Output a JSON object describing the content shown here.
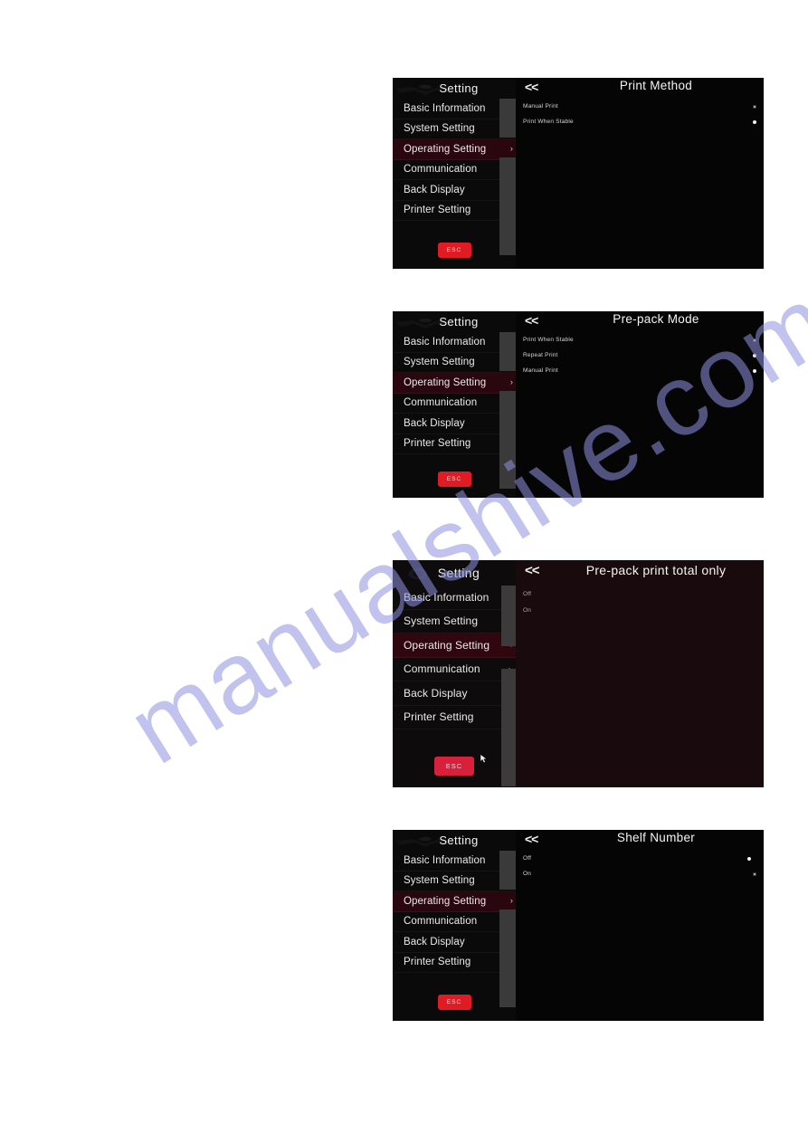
{
  "watermark": {
    "text": "manualshive.com"
  },
  "menu": {
    "title": "Setting",
    "esc_label": "ESC",
    "back_label": "<<",
    "items": [
      {
        "label": "Basic Information",
        "chevron": "›"
      },
      {
        "label": "System Setting",
        "chevron": "›"
      },
      {
        "label": "Operating Setting",
        "chevron": "›"
      },
      {
        "label": "Communication",
        "chevron": "›"
      },
      {
        "label": "Back Display",
        "chevron": "›"
      },
      {
        "label": "Printer Setting",
        "chevron": "›"
      }
    ]
  },
  "panels": [
    {
      "id": "print-method",
      "title": "Print Method",
      "selected_menu_index": 2,
      "tinted": false,
      "options": [
        {
          "label": "Manual Print",
          "marker": "hollow"
        },
        {
          "label": "Print When Stable",
          "marker": "solid"
        }
      ]
    },
    {
      "id": "pre-pack-mode",
      "title": "Pre-pack Mode",
      "selected_menu_index": 2,
      "tinted": false,
      "options": [
        {
          "label": "Print When Stable",
          "marker": "hollow"
        },
        {
          "label": "Repeat Print",
          "marker": "solid"
        },
        {
          "label": "Manual Print",
          "marker": "solid"
        }
      ]
    },
    {
      "id": "pre-pack-print-total-only",
      "title": "Pre-pack print total only",
      "selected_menu_index": 2,
      "tinted": true,
      "cursor": true,
      "options": [
        {
          "label": "Off",
          "marker": "none"
        },
        {
          "label": "On",
          "marker": "none"
        }
      ]
    },
    {
      "id": "shelf-number",
      "title": "Shelf Number",
      "selected_menu_index": 2,
      "tinted": false,
      "options": [
        {
          "label": "Off",
          "marker": "solid"
        },
        {
          "label": "On",
          "marker": "hollow"
        }
      ]
    }
  ],
  "colors": {
    "accent_red": "#e01b24",
    "selected_row": "#2a060e",
    "panel_background": "#050505",
    "panel_background_tinted": "#180a0d",
    "watermark": "#8f92e0"
  }
}
